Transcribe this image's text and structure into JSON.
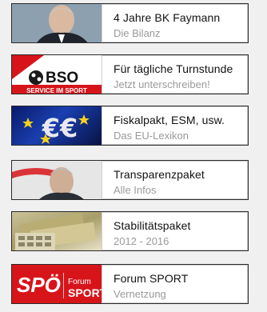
{
  "items": [
    {
      "title": "4 Jahre BK Faymann",
      "subtitle": "Die Bilanz",
      "icon": "portrait-thumbnail"
    },
    {
      "title": "Für tägliche Turnstunde",
      "subtitle": "Jetzt unterschreiben!",
      "icon": "bso-logo",
      "logo": {
        "text": "BSO",
        "band": "SERVICE IM SPORT"
      }
    },
    {
      "title": "Fiskalpakt, ESM, usw.",
      "subtitle": "Das EU-Lexikon",
      "icon": "euro-stars-thumbnail",
      "logo": {
        "glyph": "€€"
      }
    },
    {
      "title": "Transparenzpaket",
      "subtitle": "Alle Infos",
      "icon": "portrait-thumbnail"
    },
    {
      "title": "Stabilitätspaket",
      "subtitle": "2012 - 2016",
      "icon": "money-calculator-thumbnail"
    },
    {
      "title": "Forum SPORT",
      "subtitle": "Vernetzung",
      "icon": "spoe-forum-sport-logo",
      "logo": {
        "brand": "SPÖ",
        "small": "Forum",
        "big": "SPORT"
      }
    }
  ],
  "colors": {
    "card_bg": "#ffffff",
    "border": "#2a2a2a",
    "subtitle": "#9a9a9a",
    "brand_red": "#d7141a"
  }
}
